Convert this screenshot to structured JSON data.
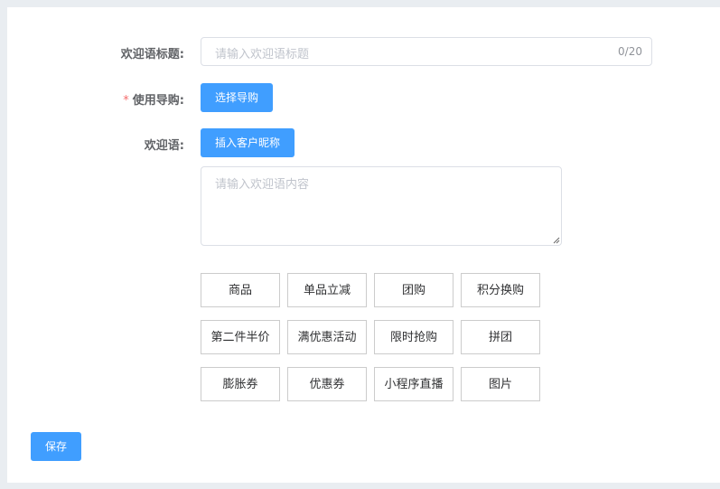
{
  "form": {
    "title_label": "欢迎语标题:",
    "title_placeholder": "请输入欢迎语标题",
    "title_counter": "0/20",
    "guide_required_mark": "*",
    "guide_label": "使用导购:",
    "guide_button": "选择导购",
    "welcome_label": "欢迎语:",
    "insert_nickname_button": "插入客户昵称",
    "content_placeholder": "请输入欢迎语内容"
  },
  "tags": [
    {
      "label": "商品"
    },
    {
      "label": "单品立减"
    },
    {
      "label": "团购"
    },
    {
      "label": "积分换购"
    },
    {
      "label": "第二件半价"
    },
    {
      "label": "满优惠活动"
    },
    {
      "label": "限时抢购"
    },
    {
      "label": "拼团"
    },
    {
      "label": "膨胀券"
    },
    {
      "label": "优惠券"
    },
    {
      "label": "小程序直播"
    },
    {
      "label": "图片"
    }
  ],
  "actions": {
    "save_button": "保存"
  },
  "colors": {
    "primary": "#409eff",
    "required": "#f56c6c",
    "background": "#e9edf1"
  }
}
